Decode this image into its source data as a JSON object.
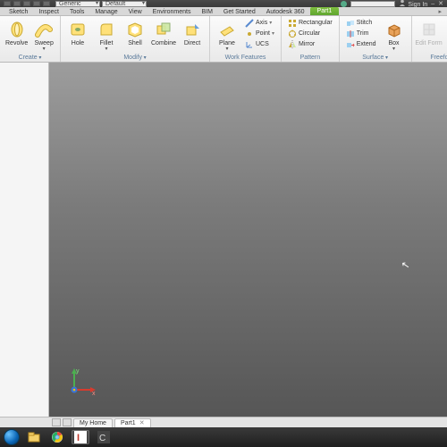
{
  "title_dropdowns": {
    "material": "Generic",
    "appearance": "Default"
  },
  "signin": "Sign In",
  "tabs": {
    "file": "Part1",
    "items": [
      "Sketch",
      "Inspect",
      "Tools",
      "Manage",
      "View",
      "Environments",
      "BIM",
      "Get Started",
      "Autodesk 360"
    ],
    "active_panel_doc": "Part1",
    "brand": "▸"
  },
  "ribbon": {
    "create": {
      "label": "Create",
      "revolve": "Revolve",
      "sweep": "Sweep"
    },
    "modify": {
      "label": "Modify",
      "hole": "Hole",
      "fillet": "Fillet",
      "shell": "Shell",
      "combine": "Combine",
      "direct": "Direct"
    },
    "workfeat": {
      "label": "Work Features",
      "plane": "Plane",
      "axis": "Axis",
      "point": "Point",
      "ucs": "UCS"
    },
    "pattern": {
      "label": "Pattern",
      "rect": "Rectangular",
      "circ": "Circular",
      "mirror": "Mirror"
    },
    "surface": {
      "label": "Surface",
      "stitch": "Stitch",
      "trim": "Trim",
      "extend": "Extend",
      "box": "Box"
    },
    "freeform": {
      "label": "Freeform",
      "edit": "Edit Form"
    }
  },
  "axes": {
    "x": "x",
    "y": "y"
  },
  "doctabs": {
    "home": "My Home",
    "part": "Part1"
  },
  "colors": {
    "accent": "#6fae2e",
    "axis_x": "#d73b2e",
    "axis_y": "#3a74d8",
    "axis_origin": "#f0c000"
  }
}
